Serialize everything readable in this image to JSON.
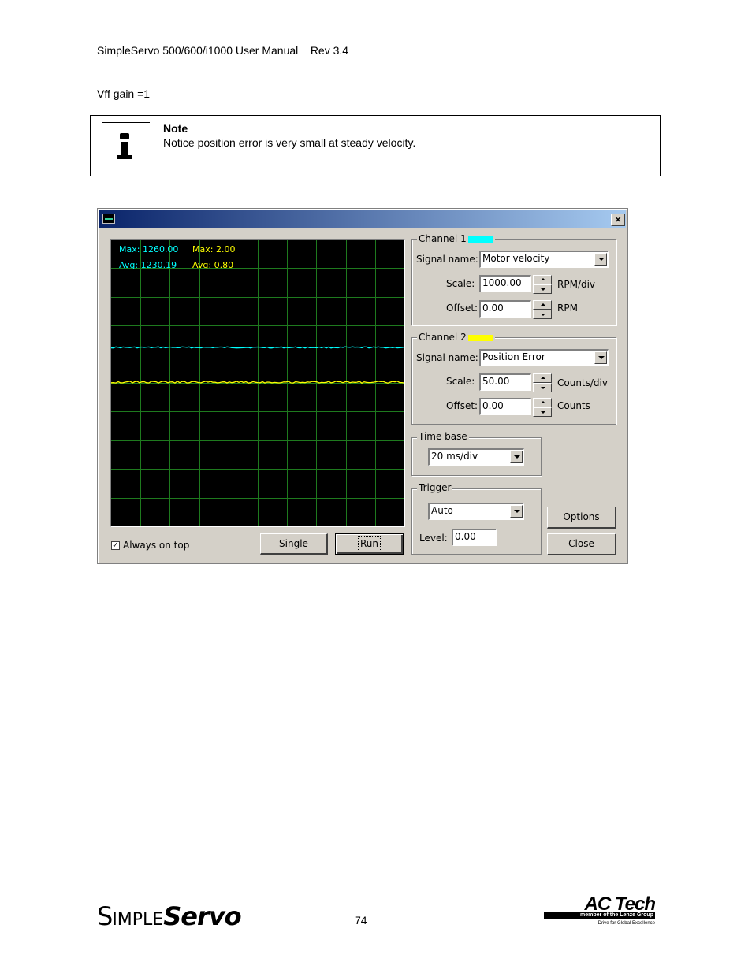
{
  "header": {
    "text": "SimpleServo 500/600/i1000 User Manual    Rev 3.4"
  },
  "intro": {
    "text": "Vff gain =1"
  },
  "note": {
    "title": "Note",
    "text": "Notice position error is very small at steady velocity.",
    "icon": "info-icon"
  },
  "dialog": {
    "title": "",
    "close_glyph": "×",
    "scope": {
      "ch1_max": "Max: 1260.00",
      "ch1_avg": "Avg: 1230.19",
      "ch2_max": "Max: 2.00",
      "ch2_avg": "Avg: 0.80",
      "ch1_color": "#00ffff",
      "ch2_color": "#ffff00",
      "grid_color": "#1e7a1e"
    },
    "always_on_top": {
      "label": "Always on top",
      "checked": true,
      "mark": "✓"
    },
    "single_button": "Single",
    "run_button": "Run",
    "channel1": {
      "label": "Channel 1",
      "color": "#00ffff",
      "signal_label": "Signal name:",
      "signal_value": "Motor velocity",
      "scale_label": "Scale:",
      "scale_value": "1000.00",
      "scale_unit": "RPM/div",
      "offset_label": "Offset:",
      "offset_value": "0.00",
      "offset_unit": "RPM"
    },
    "channel2": {
      "label": "Channel 2",
      "color": "#ffff00",
      "signal_label": "Signal name:",
      "signal_value": "Position Error",
      "scale_label": "Scale:",
      "scale_value": "50.00",
      "scale_unit": "Counts/div",
      "offset_label": "Offset:",
      "offset_value": "0.00",
      "offset_unit": "Counts"
    },
    "time_base": {
      "label": "Time base",
      "value": "20 ms/div"
    },
    "trigger": {
      "label": "Trigger",
      "mode": "Auto",
      "level_label": "Level:",
      "level_value": "0.00"
    },
    "options_button": "Options",
    "close_button": "Close"
  },
  "footer": {
    "logo_part1": "S",
    "logo_part2": "IMPLE",
    "logo_part3": "Servo",
    "page_number": "74",
    "actech_brand": "AC Tech",
    "actech_member": "member of the Lenze Group",
    "actech_tagline": "Drive for Global Excellence"
  }
}
